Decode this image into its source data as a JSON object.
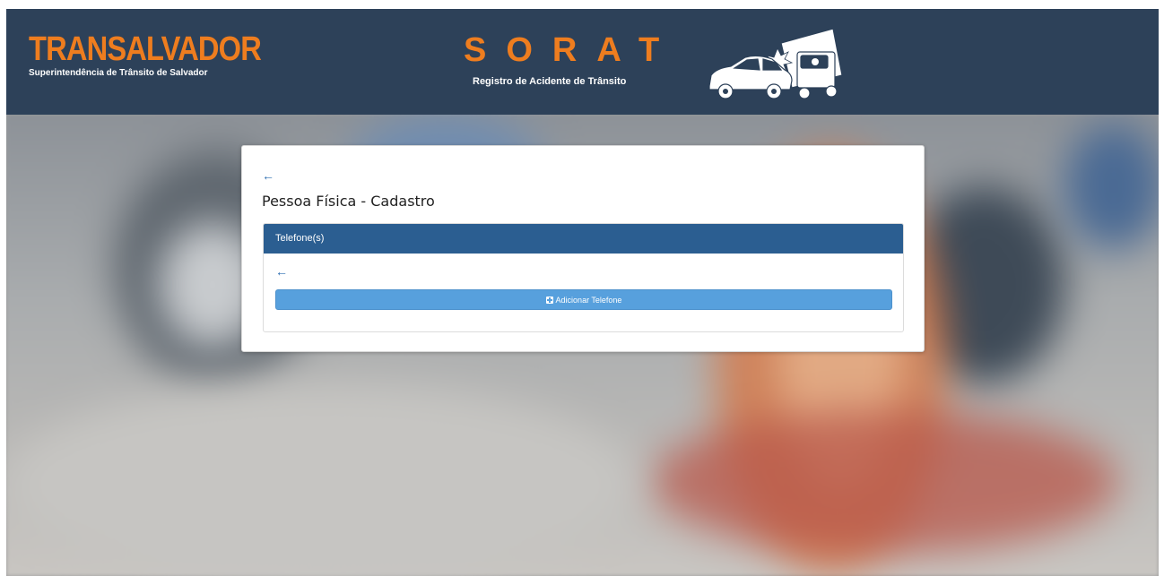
{
  "header": {
    "brand_title": "TRANSALVADOR",
    "brand_subtitle": "Superintendência de Trânsito de Salvador",
    "system_title": "SORAT",
    "system_subtitle": "Registro de Acidente de Trânsito",
    "crash_illustration": "car-crash-illustration"
  },
  "card": {
    "back_icon": "←",
    "title": "Pessoa Física - Cadastro",
    "panel": {
      "heading": "Telefone(s)",
      "back_icon": "←",
      "add_button_label": "Adicionar Telefone",
      "add_button_icon": "plus-square-icon"
    }
  },
  "colors": {
    "header_bg": "#2d4159",
    "brand_orange": "#ee7d1f",
    "panel_head": "#2b5e91",
    "button": "#57a0dd"
  }
}
